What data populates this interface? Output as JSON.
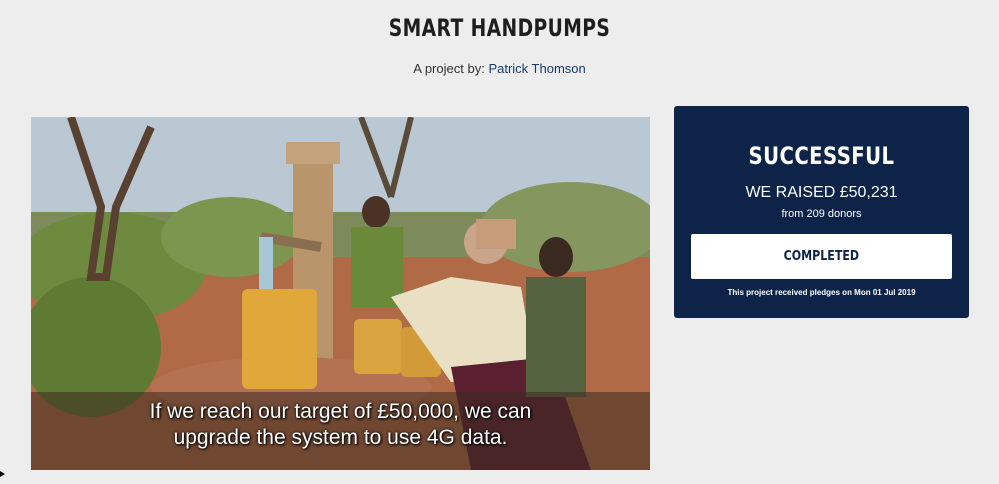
{
  "project": {
    "title": "SMART HANDPUMPS",
    "byline_prefix": "A project by:",
    "author": "Patrick Thomson"
  },
  "video": {
    "caption_line1": "If we reach our target of £50,000, we can",
    "caption_line2": "upgrade the system to use 4G data."
  },
  "status_panel": {
    "status": "SUCCESSFUL",
    "raised": "WE RAISED £50,231",
    "donors": "from 209 donors",
    "button_label": "COMPLETED",
    "pledge_note": "This project received pledges on Mon 01 Jul 2019"
  },
  "colors": {
    "panel_bg": "#0d2448",
    "page_bg": "#ededed",
    "link": "#163a6e"
  }
}
